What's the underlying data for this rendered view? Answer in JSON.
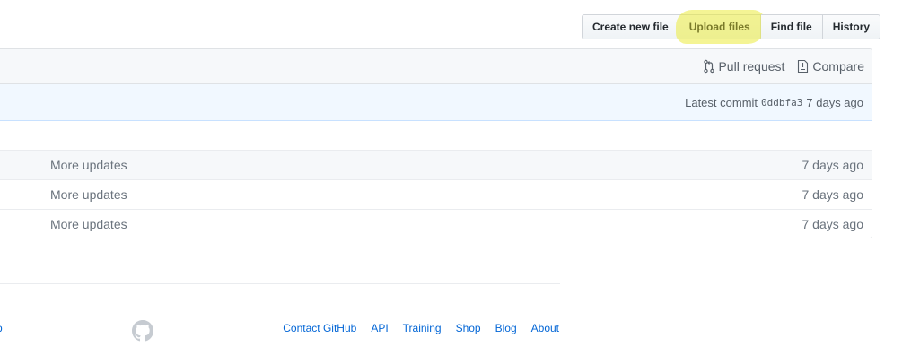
{
  "toolbar": {
    "create_new_file": "Create new file",
    "upload_files": "Upload files",
    "find_file": "Find file",
    "history": "History"
  },
  "compare_bar": {
    "pull_request": "Pull request",
    "compare": "Compare"
  },
  "commit": {
    "prefix": "Latest commit",
    "sha": "0ddbfa3",
    "age": "7 days ago"
  },
  "files": [
    {
      "message": "More updates",
      "age": "7 days ago"
    },
    {
      "message": "More updates",
      "age": "7 days ago"
    },
    {
      "message": "More updates",
      "age": "7 days ago"
    }
  ],
  "footer": {
    "left_fragment": "p",
    "links": [
      "Contact GitHub",
      "API",
      "Training",
      "Shop",
      "Blog",
      "About"
    ]
  },
  "icons": {
    "logo": "github-mark-icon",
    "pull_request": "git-pull-request-icon",
    "compare": "diff-icon"
  },
  "colors": {
    "highlight": "#ebeb3c",
    "link": "#0366d6",
    "commit_bar": "#f1f8ff"
  }
}
